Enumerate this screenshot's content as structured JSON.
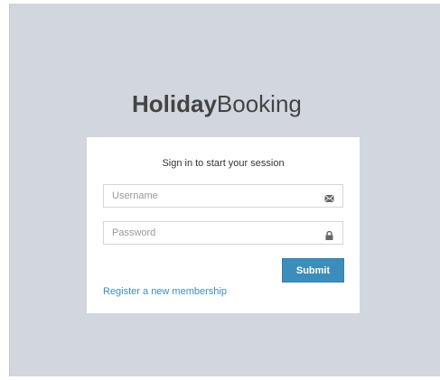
{
  "brand": {
    "bold": "Holiday",
    "light": "Booking"
  },
  "login": {
    "message": "Sign in to start your session",
    "username_placeholder": "Username",
    "password_placeholder": "Password",
    "submit_label": "Submit",
    "register_link": "Register a new membership"
  },
  "icons": {
    "username": "envelope-icon",
    "password": "lock-icon"
  },
  "colors": {
    "background": "#d2d6de",
    "accent": "#3c8dbc",
    "text": "#444444"
  }
}
